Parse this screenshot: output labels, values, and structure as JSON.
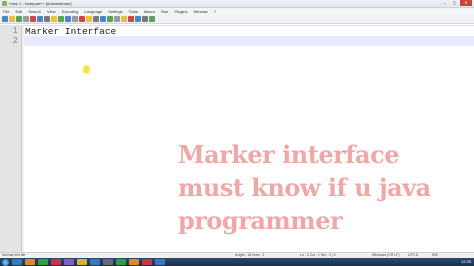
{
  "window": {
    "title": "*new 1 - Notepad++ [Administrator]",
    "buttons": [
      "–",
      "▢",
      "✕"
    ]
  },
  "menu": [
    "File",
    "Edit",
    "Search",
    "View",
    "Encoding",
    "Language",
    "Settings",
    "Tools",
    "Macro",
    "Run",
    "Plugins",
    "Window",
    "?"
  ],
  "toolbar_colors": [
    "#4a86c8",
    "#e8c33a",
    "#5aa15a",
    "#9a9a9a",
    "#c84a4a",
    "#4a86c8",
    "#7a7a7a",
    "#e8c33a",
    "#5aa15a",
    "#4a86c8",
    "#9a9a9a",
    "#c84a4a",
    "#e8c33a",
    "#7a7a7a",
    "#4a86c8",
    "#5aa15a",
    "#9a9a9a",
    "#e8c33a",
    "#c84a4a",
    "#4a86c8",
    "#7a7a7a",
    "#5aa15a"
  ],
  "editor": {
    "line_numbers": [
      "1",
      "2"
    ],
    "lines": [
      "Marker Interface",
      ""
    ]
  },
  "overlay": {
    "line1": "Marker interface",
    "line2": "must know if u java",
    "line3": "programmer"
  },
  "status": {
    "file_type": "Normal text file",
    "length": "length : 18   lines : 2",
    "position": "Ln : 2   Col : 1   Sel : 0 | 0",
    "eol": "Windows (CR LF)",
    "encoding": "UTF-8",
    "mode": "INS"
  },
  "taskbar": {
    "app_colors": [
      "#3b78c4",
      "#e0862b",
      "#2f9e44",
      "#c03b3b",
      "#8b5bbf",
      "#d8b32d",
      "#3b78c4",
      "#6b6b6b",
      "#2f9e44",
      "#e0862b",
      "#c03b3b",
      "#3b78c4"
    ],
    "clock": "12:26"
  }
}
